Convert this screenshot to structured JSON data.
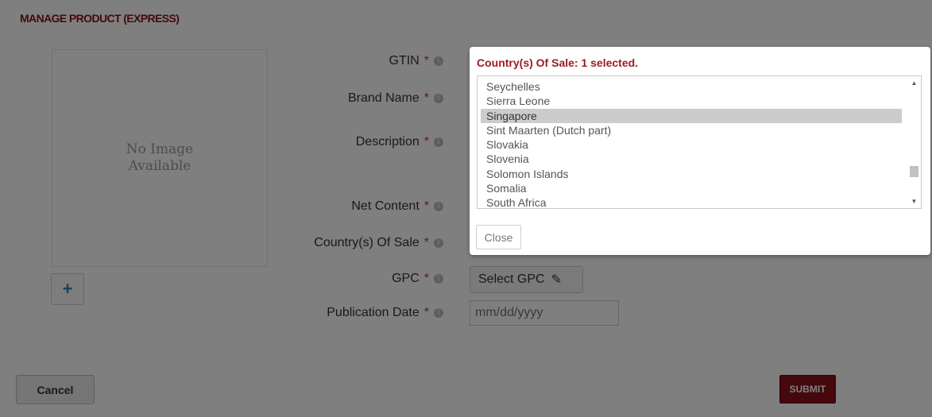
{
  "page": {
    "title": "MANAGE PRODUCT (EXPRESS)",
    "image_placeholder": "No Image Available",
    "add_image_label": "+",
    "required_mark": "*",
    "info_icon_glyph": "i"
  },
  "form": {
    "labels": {
      "gtin": "GTIN",
      "brand_name": "Brand Name",
      "description": "Description",
      "net_content": "Net Content",
      "country_of_sale": "Country(s) Of Sale",
      "gpc": "GPC",
      "publication_date": "Publication Date"
    },
    "gpc_button_label": "Select GPC",
    "publication_date_placeholder": "mm/dd/yyyy"
  },
  "actions": {
    "cancel_label": "Cancel",
    "submit_label": "SUBMIT"
  },
  "country_popup": {
    "title": "Country(s) Of Sale: 1 selected.",
    "options": [
      "Seychelles",
      "Sierra Leone",
      "Singapore",
      "Sint Maarten (Dutch part)",
      "Slovakia",
      "Slovenia",
      "Solomon Islands",
      "Somalia",
      "South Africa"
    ],
    "selected": "Singapore",
    "close_label": "Close"
  },
  "colors": {
    "brand_red": "#8b1018",
    "required_red": "#c9302c",
    "overlay": "rgba(0,0,0,0.5)"
  }
}
